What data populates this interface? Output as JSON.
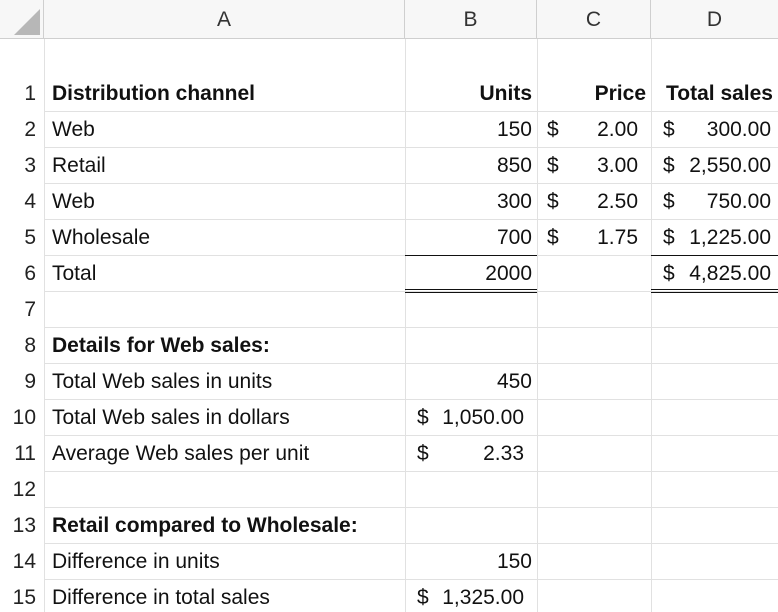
{
  "columns": [
    "A",
    "B",
    "C",
    "D"
  ],
  "rows": [
    "1",
    "2",
    "3",
    "4",
    "5",
    "6",
    "7",
    "8",
    "9",
    "10",
    "11",
    "12",
    "13",
    "14",
    "15"
  ],
  "table": {
    "headers": {
      "a": "Distribution channel",
      "b": "Units",
      "c": "Price",
      "d": "Total sales"
    },
    "lines": [
      {
        "channel": "Web",
        "units": "150",
        "price_sym": "$",
        "price": "2.00",
        "total_sym": "$",
        "total": "300.00"
      },
      {
        "channel": "Retail",
        "units": "850",
        "price_sym": "$",
        "price": "3.00",
        "total_sym": "$",
        "total": "2,550.00"
      },
      {
        "channel": "Web",
        "units": "300",
        "price_sym": "$",
        "price": "2.50",
        "total_sym": "$",
        "total": "750.00"
      },
      {
        "channel": "Wholesale",
        "units": "700",
        "price_sym": "$",
        "price": "1.75",
        "total_sym": "$",
        "total": "1,225.00"
      }
    ],
    "total": {
      "label": "Total",
      "units": "2000",
      "total_sym": "$",
      "total": "4,825.00"
    }
  },
  "web_details": {
    "heading": "Details for Web sales:",
    "units_label": "Total Web sales in units",
    "units_value": "450",
    "dollars_label": "Total Web sales in dollars",
    "dollars_sym": "$",
    "dollars_value": "1,050.00",
    "avg_label": "Average Web sales per unit",
    "avg_sym": "$",
    "avg_value": "2.33"
  },
  "comparison": {
    "heading": "Retail compared to Wholesale:",
    "units_label": "Difference in units",
    "units_value": "150",
    "sales_label": "Difference in total sales",
    "sales_sym": "$",
    "sales_value": "1,325.00"
  }
}
